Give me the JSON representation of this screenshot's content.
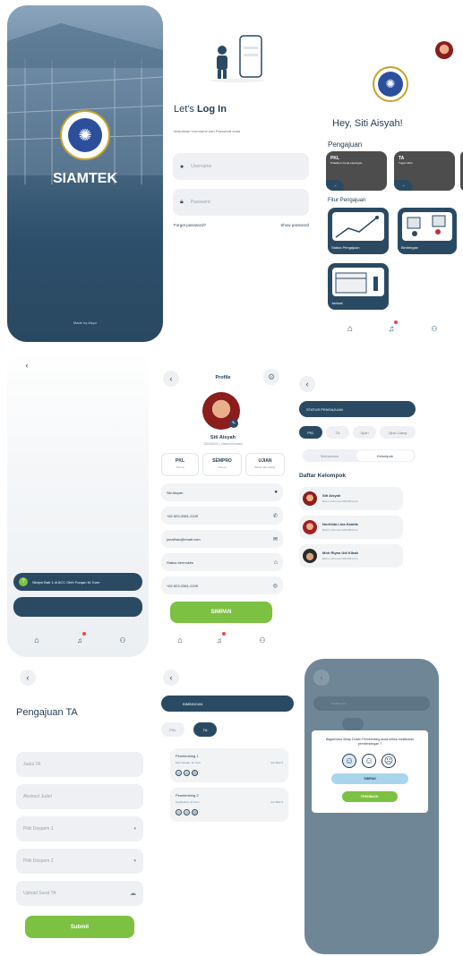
{
  "splash": {
    "brand": "SIAMTEK",
    "footer": "Made by Aisyo",
    "logo_ring": "UNIVERSITAS NURUL JADID PROBOLINGGO"
  },
  "login": {
    "title_prefix": "Let's ",
    "title_bold": "Log In",
    "subtitle": "Masukkan Username dan Password anda",
    "username_placeholder": "Username",
    "password_placeholder": "Password",
    "forgot": "Forget password?",
    "show": "Show password"
  },
  "home": {
    "greeting": "Hey, Siti Aisyah!",
    "section_pengajuan": "Pengajuan",
    "cards": [
      {
        "title": "PKL",
        "sub": "Praktikum Kerja Lapangan"
      },
      {
        "title": "TA",
        "sub": "Tugas Akhir"
      }
    ],
    "section_fitur": "Fitur Pengajuan",
    "fitur": [
      "Status Pengajuan",
      "Bimbingan",
      "Jadwal"
    ]
  },
  "notif": {
    "message": "Skripsi Bab 1 di ACC Oleh Furqan M. Kom"
  },
  "profile": {
    "header": "Profile",
    "name": "Siti Aisyah",
    "sub": "1822100XX | Sistem Informasi",
    "status": [
      {
        "label": "PKL",
        "value": "Terima"
      },
      {
        "label": "SEMPRO",
        "value": "Terima"
      },
      {
        "label": "UJIAN",
        "value": "Belum Mendaftar"
      }
    ],
    "fields": [
      "Siti Aisyah",
      "+62 823-3381-2109",
      "jonathan@email.com",
      "Status bermukim",
      "+62 823-3381-2109"
    ],
    "save": "SIMPAN"
  },
  "status": {
    "header": "STATUS PENGAJUAN",
    "tabs": [
      "PKL",
      "TA",
      "Ujian",
      "Ujian Ulang"
    ],
    "toggle": [
      "Mahasiswa",
      "Kelompok"
    ],
    "list_title": "Daftar Kelompok",
    "members": [
      {
        "name": "Siti Aisyah",
        "info": "Belum informasi 0823381xxxx"
      },
      {
        "name": "Nurhlida Lina Kamila",
        "info": "Belum informasi 0823381xxxx"
      },
      {
        "name": "Moh Riyan Udi Kibab",
        "info": "Belum informasi 0823381xxxx"
      }
    ]
  },
  "pengajuan_ta": {
    "title": "Pengajuan TA",
    "fields": [
      "Judul TA",
      "Abstract Judul",
      "Pilih Dospem 1",
      "Pilih Dospem 2",
      "Upload Surat TA"
    ],
    "submit": "Submit"
  },
  "bimbingan": {
    "header": "BIMBINGAN",
    "tabs": [
      "PKL",
      "TA"
    ],
    "items": [
      {
        "title": "Pembimbing 1",
        "name": "Moh Furqan, M. Kom",
        "acc": "Acc Bab 3"
      },
      {
        "title": "Pembimbing 2",
        "name": "Syaifiyanto, M. Kom",
        "acc": "Acc Bab 3"
      }
    ]
  },
  "rating": {
    "question": "Bagaimana Sikap Dosen Pembimbing anda ketika melakukan pembimbingan ?",
    "header": "BIMBINGAN",
    "confirm": "SIMPAN",
    "feedback": "FEEDBACK"
  },
  "colors": {
    "navy": "#2a4a63",
    "green": "#7cc142",
    "slate": "#6f8697"
  }
}
